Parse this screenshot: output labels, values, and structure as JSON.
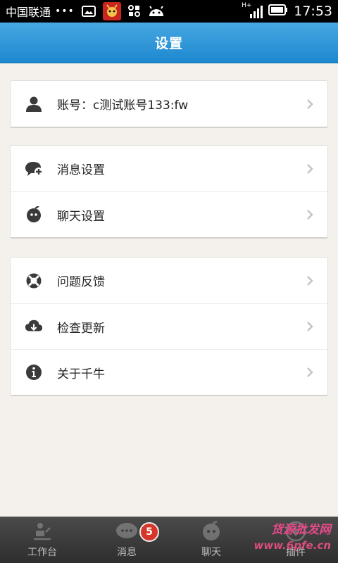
{
  "status_bar": {
    "carrier": "中国联通",
    "dots": "•••",
    "network": "H+",
    "time": "17:53"
  },
  "header": {
    "title": "设置"
  },
  "account": {
    "label": "账号：c测试账号133:fw"
  },
  "group2": {
    "items": [
      {
        "label": "消息设置",
        "icon": "message-settings-icon"
      },
      {
        "label": "聊天设置",
        "icon": "chat-settings-icon"
      }
    ]
  },
  "group3": {
    "items": [
      {
        "label": "问题反馈",
        "icon": "feedback-lifebuoy-icon"
      },
      {
        "label": "检查更新",
        "icon": "cloud-download-icon"
      },
      {
        "label": "关于千牛",
        "icon": "info-icon"
      }
    ]
  },
  "tabbar": {
    "tabs": [
      {
        "label": "工作台",
        "icon": "workbench-icon"
      },
      {
        "label": "消息",
        "icon": "message-icon",
        "badge": "5"
      },
      {
        "label": "聊天",
        "icon": "chat-icon"
      },
      {
        "label": "插件",
        "icon": "plugin-download-icon"
      }
    ]
  },
  "watermark": {
    "line1": "货源批发网",
    "line2": "www.6pfe.cn"
  },
  "colors": {
    "header_blue": "#2a93d8",
    "background": "#f4f1ec",
    "badge_red": "#d6352a"
  }
}
